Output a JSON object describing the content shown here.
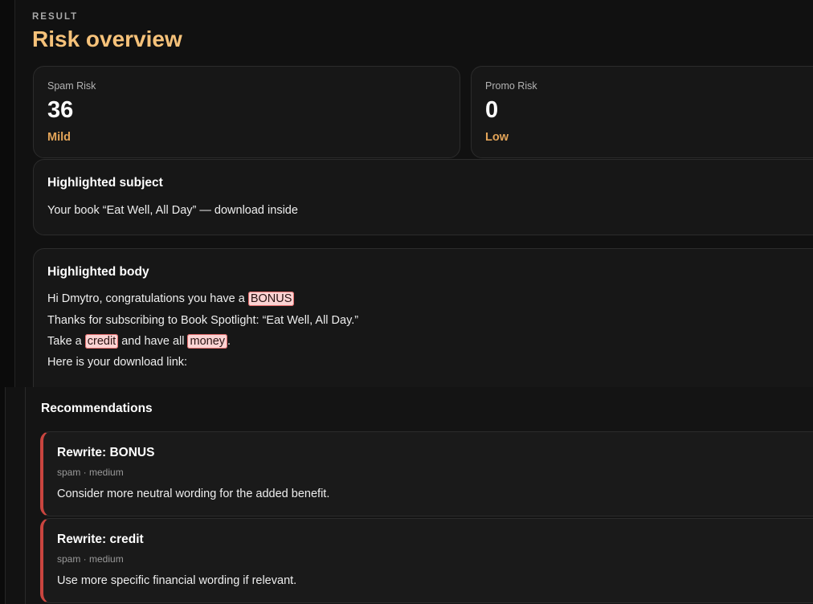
{
  "header": {
    "eyebrow": "RESULT",
    "title": "Risk overview"
  },
  "metrics": [
    {
      "label": "Spam Risk",
      "value": "36",
      "level": "Mild"
    },
    {
      "label": "Promo Risk",
      "value": "0",
      "level": "Low"
    }
  ],
  "subject": {
    "heading": "Highlighted subject",
    "text": "Your book “Eat Well, All Day” — download inside"
  },
  "body": {
    "heading": "Highlighted body",
    "line1_prefix": "Hi Dmytro, congratulations you have a ",
    "line1_highlight": "BONUS",
    "line2": "Thanks for subscribing to Book Spotlight: “Eat Well, All Day.”",
    "line3_prefix": "Take a ",
    "line3_highlight1": "credit",
    "line3_middle": " and have all ",
    "line3_highlight2": "money",
    "line3_suffix": ".",
    "line4": "Here is your download link:"
  },
  "recommendations": {
    "heading": "Recommendations",
    "items": [
      {
        "title": "Rewrite: BONUS",
        "meta": "spam · medium",
        "text": "Consider more neutral wording for the added benefit."
      },
      {
        "title": "Rewrite: credit",
        "meta": "spam · medium",
        "text": "Use more specific financial wording if relevant."
      }
    ]
  },
  "colors": {
    "title_accent": "#f6c27a",
    "level_accent": "#e3a458",
    "highlight_bg": "#fbd3d3",
    "highlight_border": "#e26b6b",
    "recommendation_bar": "#c9453f"
  }
}
